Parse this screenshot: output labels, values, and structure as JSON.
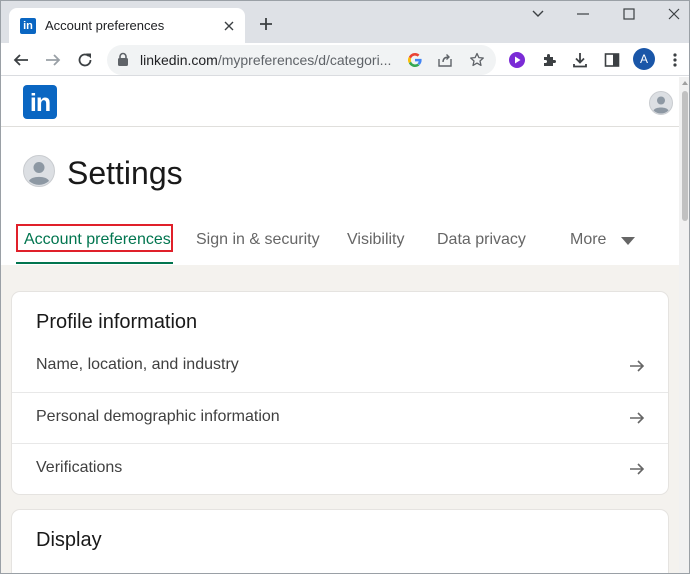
{
  "browser": {
    "tab_title": "Account preferences",
    "tab_favicon": "in",
    "new_tab_label": "+",
    "url_host": "linkedin.com",
    "url_path": "/mypreferences/d/categori...",
    "profile_initial": "A"
  },
  "page": {
    "logo_text": "in",
    "title": "Settings",
    "tabs": [
      {
        "label": "Account preferences",
        "active": true
      },
      {
        "label": "Sign in & security",
        "active": false
      },
      {
        "label": "Visibility",
        "active": false
      },
      {
        "label": "Data privacy",
        "active": false
      },
      {
        "label": "More",
        "active": false
      }
    ],
    "profile_card": {
      "title": "Profile information",
      "items": [
        "Name, location, and industry",
        "Personal demographic information",
        "Verifications"
      ]
    },
    "display_card": {
      "title": "Display"
    }
  },
  "colors": {
    "linkedin_blue": "#0a66c2",
    "active_tab_green": "#01754f",
    "highlight_red": "#e0202a",
    "page_background": "#f4f2ee"
  }
}
